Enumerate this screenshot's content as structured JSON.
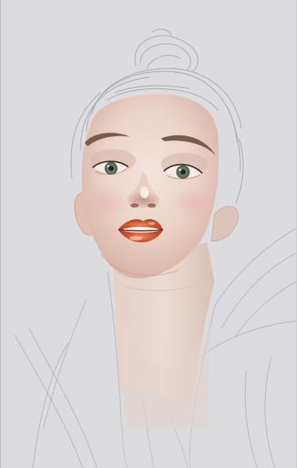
{
  "artwork": {
    "subject": "portrait-painting-in-progress",
    "colors": {
      "canvas_background": "#dcdbdd",
      "skin_light": "#f1dfd6",
      "skin_mid": "#e2c4b6",
      "skin_shadow": "#c79a88",
      "lips": "#c8522f",
      "eyes": "#6d7a6c",
      "brows": "#7a5a48",
      "sketch_lines": "#8f8e92"
    }
  }
}
